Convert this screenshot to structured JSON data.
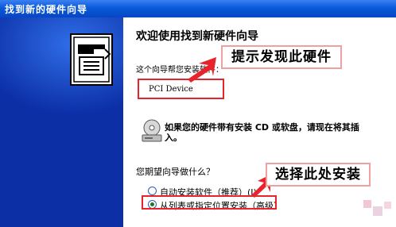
{
  "window": {
    "title": "找到新的硬件向导"
  },
  "main": {
    "heading": "欢迎使用找到新硬件向导",
    "description": "这个向导帮您安装软件：",
    "device_name": "PCI Device",
    "cd_hint": "如果您的硬件带有安装 CD 或软盘，请现在将其插入。",
    "question": "您期望向导做什么？",
    "options": [
      {
        "label": "自动安装软件（推荐）(I)",
        "selected": false
      },
      {
        "label": "从列表或指定位置安装（高级）",
        "selected": true
      }
    ]
  },
  "annotations": {
    "callout1": "提示发现此硬件",
    "callout2": "选择此处安装",
    "color": "#e8232b"
  },
  "theme": {
    "titlebar": "#0a5ad8",
    "sidepanel": "#0c2fa6",
    "background": "#ffffff"
  }
}
